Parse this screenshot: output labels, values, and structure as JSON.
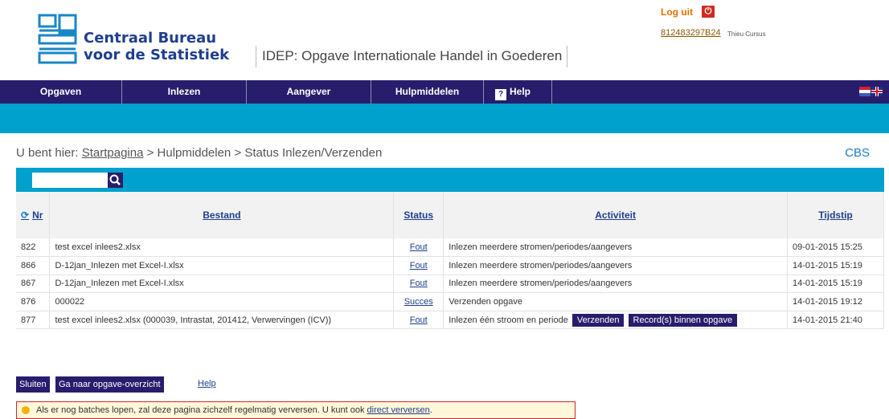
{
  "header": {
    "logo_line1": "Centraal Bureau",
    "logo_line2": "voor de Statistiek",
    "app_title": "IDEP: Opgave Internationale Handel in Goederen",
    "logout_label": "Log uit",
    "user_id": "812483297B24",
    "user_name": "Thieu Cursus"
  },
  "nav": {
    "items": [
      {
        "label": "Opgaven"
      },
      {
        "label": "Inlezen"
      },
      {
        "label": "Aangever"
      },
      {
        "label": "Hulpmiddelen"
      },
      {
        "label": "Help"
      }
    ]
  },
  "breadcrumb": {
    "prefix": "U bent hier:",
    "home": "Startpagina",
    "rest": "> Hulpmiddelen > Status Inlezen/Verzenden",
    "cbs": "CBS"
  },
  "table": {
    "headers": {
      "nr": "Nr",
      "bestand": "Bestand",
      "status": "Status",
      "activiteit": "Activiteit",
      "tijdstip": "Tijdstip"
    },
    "rows": [
      {
        "nr": "822",
        "bestand": "test excel inlees2.xlsx",
        "status": "Fout",
        "activiteit": "Inlezen meerdere stromen/periodes/aangevers",
        "tijdstip": "09-01-2015 15:25"
      },
      {
        "nr": "866",
        "bestand": "D-12jan_Inlezen met Excel-I.xlsx",
        "status": "Fout",
        "activiteit": "Inlezen meerdere stromen/periodes/aangevers",
        "tijdstip": "14-01-2015 15:19"
      },
      {
        "nr": "867",
        "bestand": "D-12jan_Inlezen met Excel-I.xlsx",
        "status": "Fout",
        "activiteit": "Inlezen meerdere stromen/periodes/aangevers",
        "tijdstip": "14-01-2015 15:19"
      },
      {
        "nr": "876",
        "bestand": "000022",
        "status": "Succes",
        "activiteit": "Verzenden opgave",
        "tijdstip": "14-01-2015 19:12"
      },
      {
        "nr": "877",
        "bestand": "test excel inlees2.xlsx (000039, Intrastat, 201412, Verwervingen (ICV))",
        "status": "Fout",
        "activiteit": "Inlezen één stroom en periode",
        "tijdstip": "14-01-2015 21:40",
        "btn1": "Verzenden",
        "btn2": "Record(s) binnen opgave"
      }
    ]
  },
  "actions": {
    "close": "Sluiten",
    "overview": "Ga naar opgave-overzicht",
    "help": "Help"
  },
  "notice": {
    "text": "Als er nog batches lopen, zal deze pagina zichzelf regelmatig verversen. U kunt ook",
    "link": "direct verversen",
    "suffix": "."
  }
}
